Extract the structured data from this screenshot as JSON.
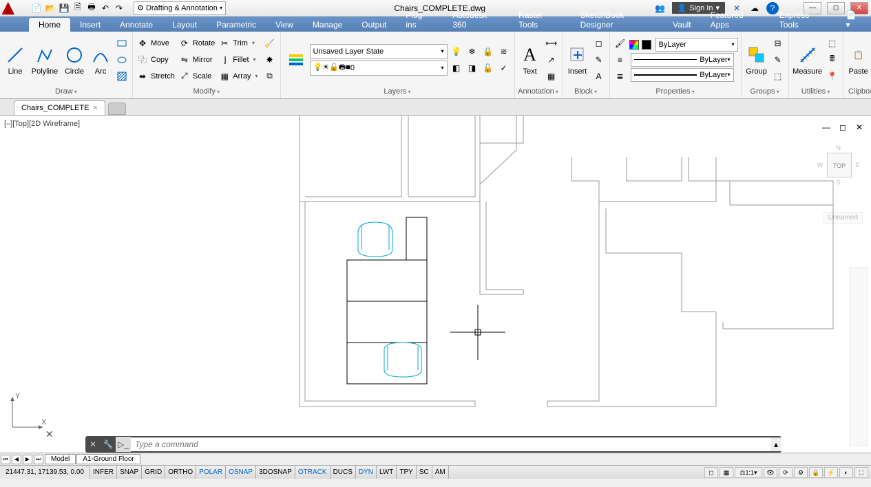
{
  "title": "Chairs_COMPLETE.dwg",
  "workspace": "Drafting & Annotation",
  "signin": "Sign In",
  "tabs": [
    "Home",
    "Insert",
    "Annotate",
    "Layout",
    "Parametric",
    "View",
    "Manage",
    "Output",
    "Plug-ins",
    "Autodesk 360",
    "Raster Tools",
    "SketchBook Designer",
    "Vault",
    "Featured Apps",
    "Express Tools"
  ],
  "active_tab": "Home",
  "panels": {
    "draw": {
      "label": "Draw",
      "tools": [
        "Line",
        "Polyline",
        "Circle",
        "Arc"
      ]
    },
    "modify": {
      "label": "Modify",
      "tools": {
        "move": "Move",
        "copy": "Copy",
        "stretch": "Stretch",
        "rotate": "Rotate",
        "mirror": "Mirror",
        "scale": "Scale",
        "trim": "Trim",
        "fillet": "Fillet",
        "array": "Array"
      }
    },
    "layers": {
      "label": "Layers",
      "state": "Unsaved Layer State",
      "current": "0"
    },
    "annotation": {
      "label": "Annotation",
      "text": "Text"
    },
    "block": {
      "label": "Block",
      "insert": "Insert"
    },
    "properties": {
      "label": "Properties",
      "color": "ByLayer",
      "ltype": "ByLayer",
      "lweight": "ByLayer"
    },
    "groups": {
      "label": "Groups",
      "group": "Group"
    },
    "utilities": {
      "label": "Utilities",
      "measure": "Measure"
    },
    "clipboard": {
      "label": "Clipboard",
      "paste": "Paste"
    }
  },
  "file_tab": "Chairs_COMPLETE",
  "view_label": "[–][Top][2D Wireframe]",
  "viewcube": {
    "top": "TOP",
    "n": "N",
    "s": "S",
    "e": "E",
    "w": "W",
    "unnamed": "Unnamed"
  },
  "cmdline_placeholder": "Type a command",
  "layout_tabs": [
    "Model",
    "A1-Ground Floor"
  ],
  "coords": "21447.31, 17139.53, 0.00",
  "toggles": [
    "INFER",
    "SNAP",
    "GRID",
    "ORTHO",
    "POLAR",
    "OSNAP",
    "3DOSNAP",
    "OTRACK",
    "DUCS",
    "DYN",
    "LWT",
    "TPY",
    "SC",
    "AM"
  ],
  "toggles_on": [
    "POLAR",
    "OSNAP",
    "OTRACK",
    "DYN"
  ],
  "anno_scale": "1:1"
}
